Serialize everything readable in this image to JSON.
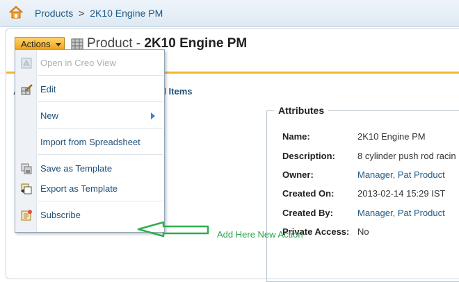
{
  "breadcrumb": {
    "items": [
      "Products",
      "2K10 Engine PM"
    ],
    "separator": ">"
  },
  "header": {
    "actions_label": "Actions",
    "title_prefix": "Product - ",
    "title_name": "2K10 Engine PM"
  },
  "tabs": {
    "first": "A",
    "second": "d Items"
  },
  "menu": {
    "items": [
      {
        "label": "Open in Creo View",
        "icon": "creo-view-icon",
        "enabled": false
      },
      {
        "label": "Edit",
        "icon": "edit-icon",
        "enabled": true
      },
      {
        "label": "New",
        "icon": "",
        "enabled": true,
        "submenu": true
      },
      {
        "label": "Import from Spreadsheet",
        "icon": "",
        "enabled": true
      },
      {
        "label": "Save as Template",
        "icon": "save-template-icon",
        "enabled": true
      },
      {
        "label": "Export as Template",
        "icon": "export-template-icon",
        "enabled": true
      },
      {
        "label": "Subscribe",
        "icon": "subscribe-icon",
        "enabled": true
      }
    ]
  },
  "attributes": {
    "legend": "Attributes",
    "rows": [
      {
        "label": "Name:",
        "value": "2K10 Engine PM",
        "link": false
      },
      {
        "label": "Description:",
        "value": "8 cylinder push rod racin",
        "link": false
      },
      {
        "label": "Owner:",
        "value": "Manager, Pat Product",
        "link": true
      },
      {
        "label": "Created On:",
        "value": "2013-02-14 15:29 IST",
        "link": false
      },
      {
        "label": "Created By:",
        "value": "Manager, Pat Product",
        "link": true
      },
      {
        "label": "Private Access:",
        "value": "No",
        "link": false
      }
    ]
  },
  "annotation": {
    "text": "Add Here New Action",
    "color": "#26a34a"
  },
  "colors": {
    "accent_orange": "#f2b632",
    "link_blue": "#1f5a86"
  }
}
